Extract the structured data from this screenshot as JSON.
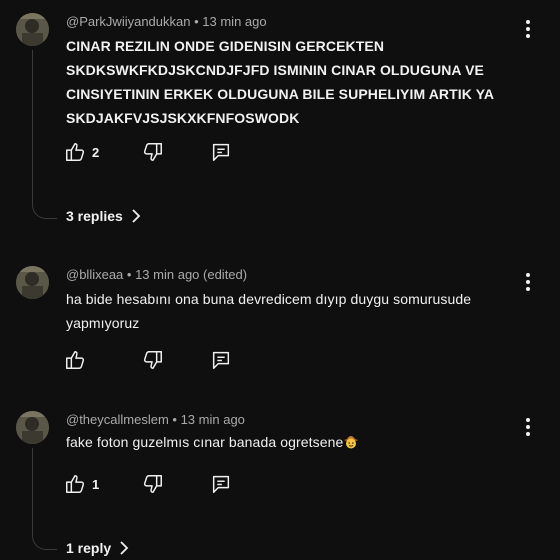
{
  "comments": [
    {
      "handle": "@ParkJwiiyandukkan",
      "time": "13 min ago",
      "text": "CINAR REZILIN ONDE GIDENISIN GERCEKTEN SKDKSWKFKDJSKCNDJFJFD ISMININ CINAR OLDUGUNA VE CINSIYETININ ERKEK OLDUGUNA BILE SUPHELIYIM ARTIK YA SKDJAKFVJSJSKXKFNFOSWODK",
      "likes": "2",
      "replies": "3 replies"
    },
    {
      "handle": "@bllixeaa",
      "time": "13 min ago (edited)",
      "text": "ha bide hesabını ona buna devredicem dıyıp duygu somurusude yapmıyoruz",
      "likes": ""
    },
    {
      "handle": "@theycallmeslem",
      "time": "13 min ago",
      "text": "fake foton guzelmıs cınar banada ogretsene",
      "likes": "1",
      "replies": "1 reply"
    }
  ],
  "icons": {
    "like": "thumb-up-icon",
    "dislike": "thumb-down-icon",
    "reply": "reply-comment-icon",
    "menu": "more-vertical-icon",
    "chevron": "chevron-right-icon",
    "emoji": "cowboy-face-emoji"
  },
  "colors": {
    "background": "#0f0f0f",
    "text": "#f1f1f1",
    "meta": "#aaaaaa"
  }
}
